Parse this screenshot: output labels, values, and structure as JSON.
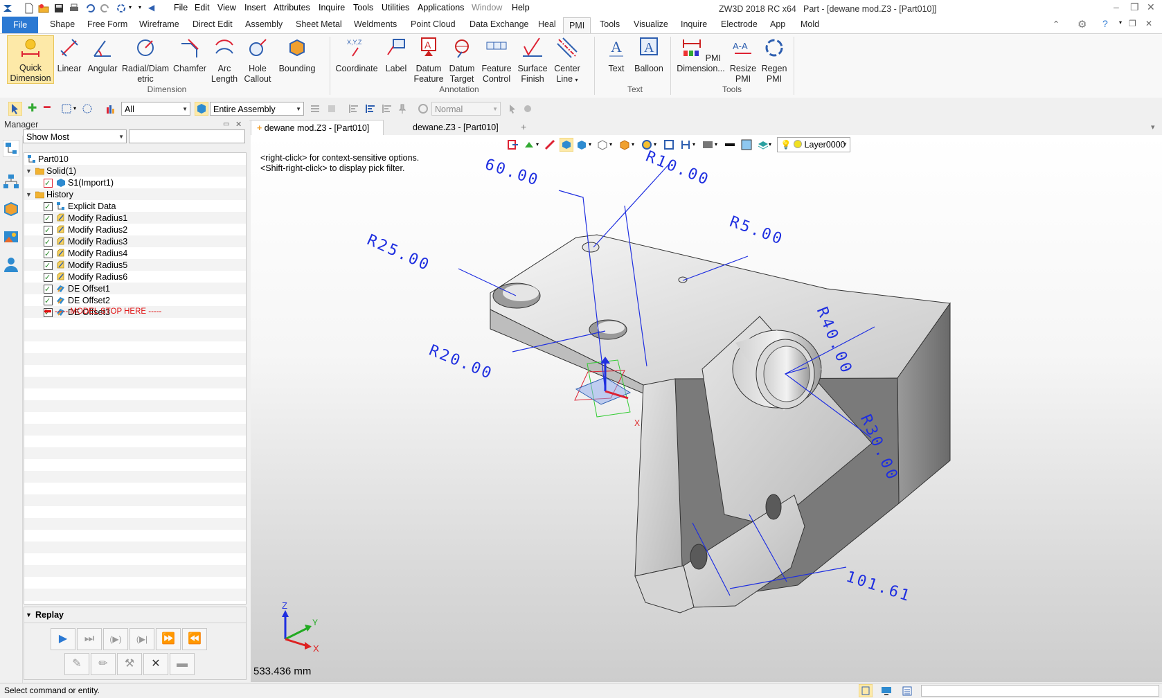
{
  "app_title": "ZW3D 2018 RC x64",
  "doc_title": "Part - [dewane mod.Z3 - [Part010]]",
  "menu": [
    "File",
    "Edit",
    "View",
    "Insert",
    "Attributes",
    "Inquire",
    "Tools",
    "Utilities",
    "Applications",
    "Window",
    "Help"
  ],
  "ribbon_tabs": [
    "File",
    "Shape",
    "Free Form",
    "Wireframe",
    "Direct Edit",
    "Assembly",
    "Sheet Metal",
    "Weldments",
    "Point Cloud",
    "Data Exchange",
    "Heal",
    "PMI",
    "Tools",
    "Visualize",
    "Inquire",
    "Electrode",
    "App",
    "Mold"
  ],
  "active_tab": "PMI",
  "ribbon": {
    "dimension": {
      "group_label": "Dimension",
      "quick_dimension": "Quick Dimension",
      "linear": "Linear",
      "angular": "Angular",
      "radial": "Radial/Diam etric",
      "chamfer": "Chamfer",
      "arc_length": "Arc Length",
      "hole_callout": "Hole Callout",
      "bounding": "Bounding"
    },
    "annotation": {
      "group_label": "Annotation",
      "coordinate": "Coordinate",
      "label": "Label",
      "datum_feature": "Datum Feature",
      "datum_target": "Datum Target",
      "feature_control": "Feature Control",
      "surface_finish": "Surface Finish",
      "center_line": "Center Line"
    },
    "text": {
      "group_label": "Text",
      "text": "Text",
      "balloon": "Balloon"
    },
    "tools": {
      "group_label": "Tools",
      "pmi_dimension": "PMI Dimension...",
      "resize_pmi": "Resize PMI",
      "regen_pmi": "Regen PMI"
    }
  },
  "filter": {
    "pick_filter": "All",
    "scope": "Entire Assembly",
    "style": "Normal"
  },
  "manager": {
    "title": "Manager",
    "show_filter": "Show Most",
    "search_placeholder": "",
    "tree": {
      "root": "Part010",
      "solid_group": "Solid(1)",
      "solid_item": "S1(Import1)",
      "history_group": "History",
      "history_items": [
        "Explicit Data",
        "Modify Radius1",
        "Modify Radius2",
        "Modify Radius3",
        "Modify Radius4",
        "Modify Radius5",
        "Modify Radius6",
        "DE Offset1",
        "DE Offset2",
        "DE Offset3"
      ],
      "stop_marker": "----- MODEL STOP HERE -----"
    },
    "replay_label": "Replay"
  },
  "doc_tabs": [
    {
      "label": "dewane mod.Z3 - [Part010]",
      "active": true
    },
    {
      "label": "dewane.Z3 - [Part010]",
      "active": false
    }
  ],
  "viewport": {
    "layer": "Layer0000",
    "hint_right_click": "<right-click> for context-sensitive options.",
    "hint_shift_right_click": "<Shift-right-click> to display pick filter.",
    "measure": "533.436 mm",
    "dimensions": [
      "60.00",
      "R10.00",
      "R5.00",
      "R25.00",
      "R40.00",
      "R20.00",
      "R30.00",
      "101.61"
    ],
    "axis_x": "X",
    "axis_y": "Y",
    "axis_z": "Z"
  },
  "status_text": "Select command or entity.",
  "colors": {
    "file_tab": "#2b79d3",
    "pmi_blue": "#1f2fe0",
    "selected_button": "#fde9a8"
  }
}
